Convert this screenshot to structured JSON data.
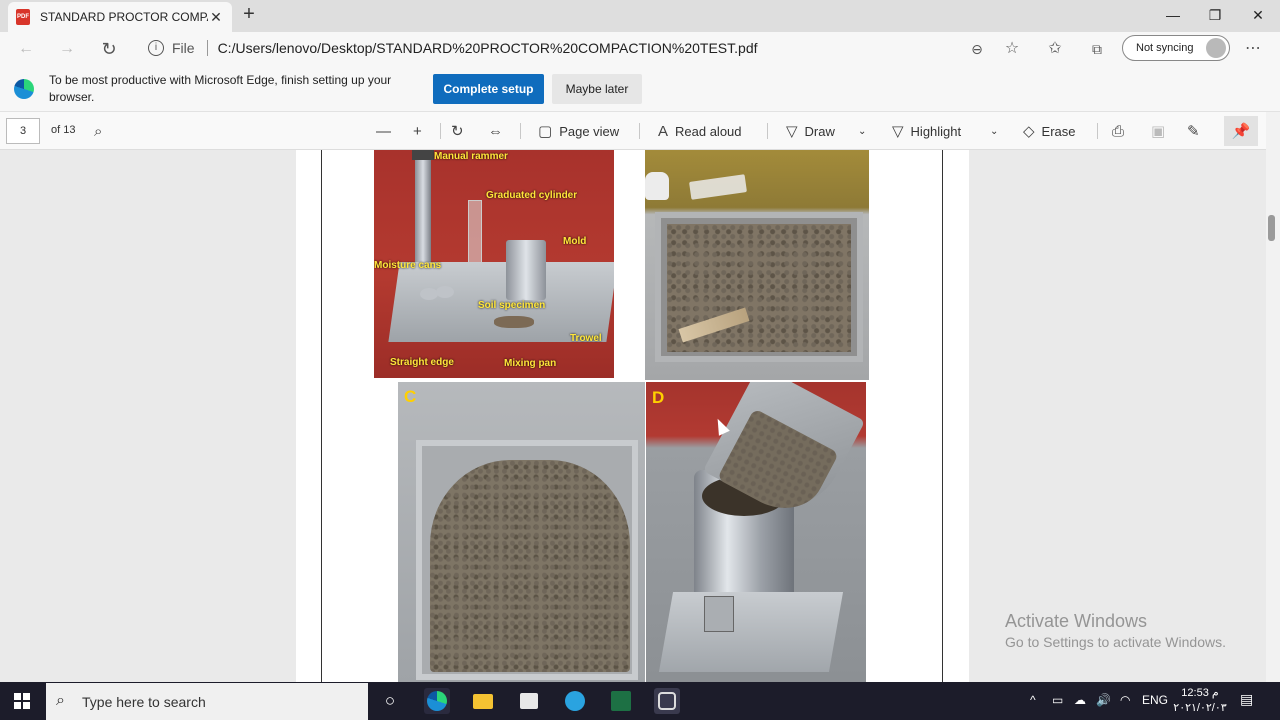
{
  "window": {
    "tab_title": "STANDARD PROCTOR COMPACT",
    "minimize": "—",
    "restore": "❐",
    "close": "✕"
  },
  "address_bar": {
    "scheme_label": "File",
    "url": "C:/Users/lenovo/Desktop/STANDARD%20PROCTOR%20COMPACTION%20TEST.pdf",
    "sync_label": "Not syncing"
  },
  "banner": {
    "message": "To be most productive with Microsoft Edge, finish setting up your browser.",
    "primary_button": "Complete setup",
    "secondary_button": "Maybe later"
  },
  "pdf_toolbar": {
    "current_page": "3",
    "page_count": "of 13",
    "page_view": "Page view",
    "read_aloud": "Read aloud",
    "draw": "Draw",
    "highlight": "Highlight",
    "erase": "Erase"
  },
  "document": {
    "photo_a_labels": {
      "manual_rammer": "Manual rammer",
      "graduated_cylinder": "Graduated cylinder",
      "mold": "Mold",
      "moisture_cans": "Moisture cans",
      "soil_specimen": "Soil specimen",
      "trowel": "Trowel",
      "straight_edge": "Straight edge",
      "mixing_pan": "Mixing pan"
    },
    "photo_c_letter": "C",
    "photo_d_letter": "D"
  },
  "watermark": {
    "title": "Activate Windows",
    "subtitle": "Go to Settings to activate Windows."
  },
  "taskbar": {
    "search_placeholder": "Type here to search",
    "language": "ENG",
    "time": "12:53 م",
    "date": "۲۰۲۱/۰۲/۰۳"
  }
}
